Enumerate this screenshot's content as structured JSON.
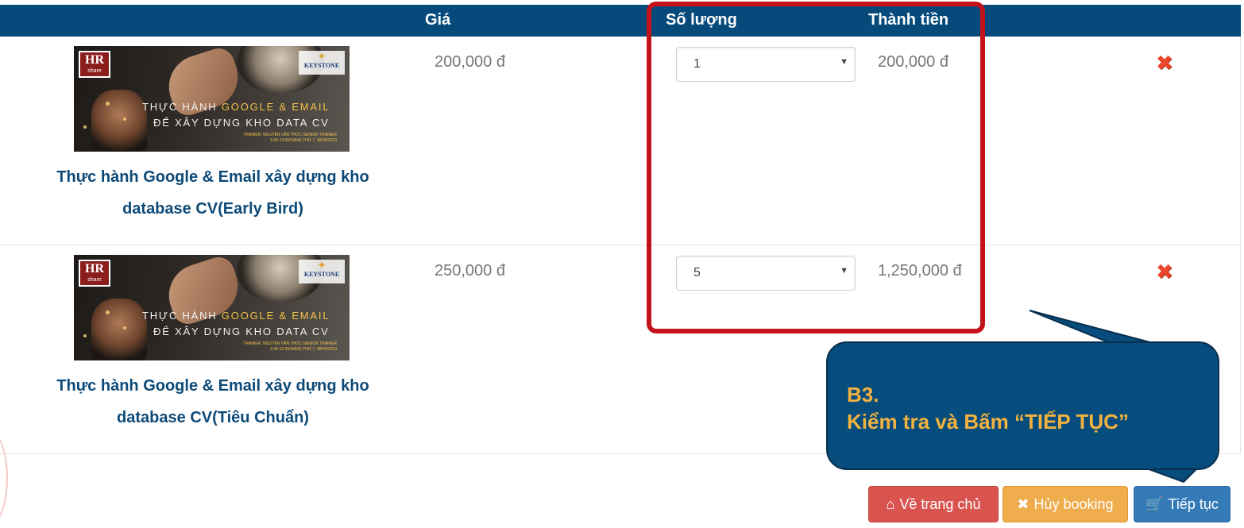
{
  "table": {
    "headers": {
      "price": "Giá",
      "quantity": "Số lượng",
      "total": "Thành tiền"
    },
    "rows": [
      {
        "thumb": {
          "hr_logo": "HR",
          "hr_logo_sub": "share",
          "keystone_logo": "KEYSTONE",
          "line1_a": "THỰC HÀNH",
          "line1_b": "GOOGLE & EMAIL",
          "line2": "ĐỂ XÂY DỰNG KHO DATA CV",
          "line3": "TRAINER: NGUYỄN VĂN THỨC-SENIOR TRAINER",
          "line4": "9:30-12:00/SÁNG THỨ 7, 08/06/2019"
        },
        "name": "Thực hành Google & Email xây dựng kho database CV(Early Bird)",
        "price": "200,000 đ",
        "quantity": "1",
        "total": "200,000 đ",
        "delete_icon": "close-x-icon"
      },
      {
        "thumb": {
          "hr_logo": "HR",
          "hr_logo_sub": "share",
          "keystone_logo": "KEYSTONE",
          "line1_a": "THỰC HÀNH",
          "line1_b": "GOOGLE & EMAIL",
          "line2": "ĐỂ XÂY DỰNG KHO DATA CV",
          "line3": "TRAINER: NGUYỄN VĂN THỨC-SENIOR TRAINER",
          "line4": "9:30-12:00/SÁNG THỨ 7, 08/06/2019"
        },
        "name": "Thực hành Google & Email xây dựng kho database CV(Tiêu Chuẩn)",
        "price": "250,000 đ",
        "quantity": "5",
        "total": "1,250,000 đ",
        "delete_icon": "close-x-icon"
      }
    ]
  },
  "callout": {
    "step": "B3.",
    "text": "Kiểm tra và Bấm “TIẾP TỤC”"
  },
  "buttons": {
    "home": {
      "icon": "home-icon",
      "label": "Về trang chủ"
    },
    "cancel": {
      "icon": "x-icon",
      "label": "Hủy booking"
    },
    "next": {
      "icon": "cart-icon",
      "label": "Tiếp tục"
    }
  },
  "colors": {
    "header_bg": "#054a7b",
    "highlight_box": "#c4121b",
    "callout_bg": "#064c7c",
    "callout_text": "#f3b23f",
    "btn_home": "#d9534f",
    "btn_cancel": "#f0ad4e",
    "btn_next": "#337ab7"
  }
}
